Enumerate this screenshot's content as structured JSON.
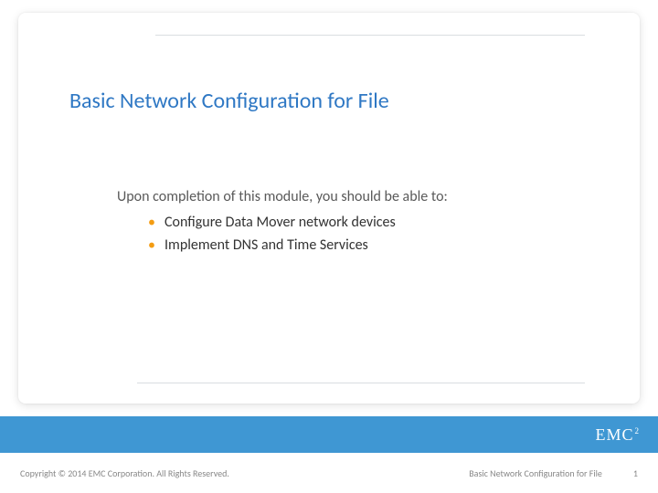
{
  "title": "Basic Network Configuration for File",
  "intro": "Upon completion of this module, you should be able to:",
  "bullets": [
    "Configure Data Mover network devices",
    "Implement DNS and Time Services"
  ],
  "footer": {
    "logo_main": "EMC",
    "logo_sup": "2",
    "copyright": "Copyright © 2014 EMC Corporation. All Rights Reserved.",
    "module_name": "Basic Network Configuration for File",
    "page_number": "1"
  }
}
